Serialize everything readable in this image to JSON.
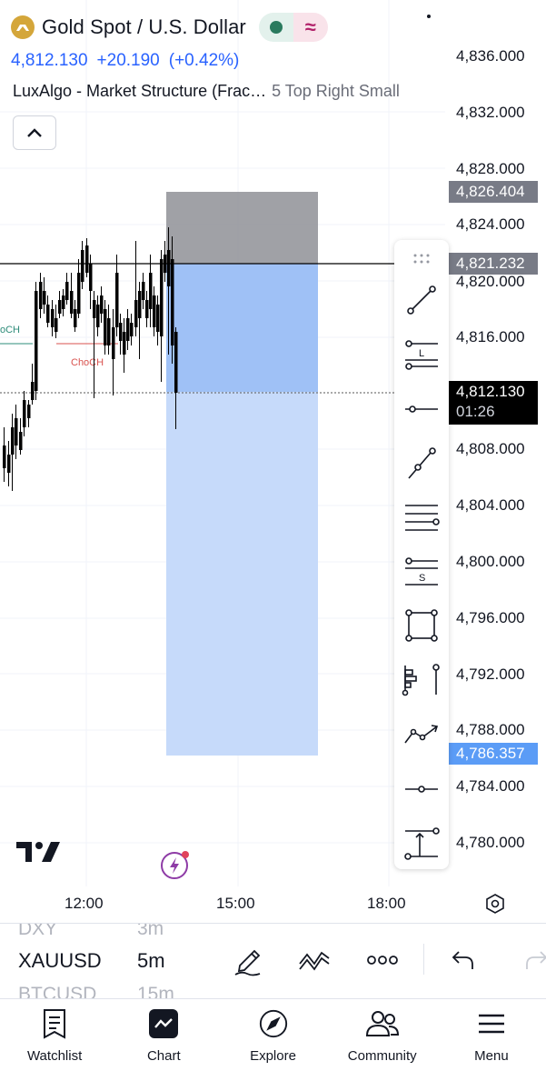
{
  "header": {
    "symbol_title": "Gold Spot / U.S. Dollar",
    "last_price": "4,812.130",
    "change": "+20.190",
    "change_pct": "(+0.42%)",
    "indicator_name": "LuxAlgo - Market Structure (Frac…",
    "indicator_params": "5 Top Right Small",
    "market_status_icon": "market-open-dot-icon",
    "data_feed_icon": "realtime-wave-icon"
  },
  "price_axis": {
    "labels": [
      "4,836.000",
      "4,832.000",
      "4,828.000",
      "4,824.000",
      "4,820.000",
      "4,816.000",
      "4,808.000",
      "4,804.000",
      "4,800.000",
      "4,796.000",
      "4,792.000",
      "4,788.000",
      "4,784.000",
      "4,780.000"
    ],
    "tag_stop": "4,826.404",
    "tag_entry": "4,821.232",
    "tag_current_price": "4,812.130",
    "tag_countdown": "01:26",
    "tag_target": "4,786.357"
  },
  "chart": {
    "choch_label_left": "oCH",
    "choch_label_mid": "ChoCH",
    "colors": {
      "up_candle": "#2962ff",
      "down_candle": "#000000",
      "stop_zone": "#8f9196",
      "target_zone_dark": "#9fc1f6",
      "target_zone_light": "#c6dafa",
      "choch_bull": "#2e8c7a",
      "choch_bear": "#d9534f"
    }
  },
  "time_axis": {
    "labels": [
      "12:00",
      "15:00",
      "18:00"
    ]
  },
  "drawing_tools": [
    "trend-line-icon",
    "long-position-lines-icon",
    "horizontal-ray-icon",
    "ray-line-icon",
    "parallel-channel-icon",
    "short-position-lines-icon",
    "rectangle-icon",
    "price-range-icon",
    "path-arrow-icon",
    "horizontal-segment-icon",
    "vertical-measure-icon"
  ],
  "symbol_bar": {
    "prev_symbol": "DXY",
    "prev_interval": "3m",
    "current_symbol": "XAUUSD",
    "current_interval": "5m",
    "next_symbol": "BTCUSD",
    "next_interval": "15m"
  },
  "bottom_nav": [
    {
      "label": "Watchlist",
      "icon": "watchlist-icon"
    },
    {
      "label": "Chart",
      "icon": "chart-icon"
    },
    {
      "label": "Explore",
      "icon": "compass-icon"
    },
    {
      "label": "Community",
      "icon": "community-icon"
    },
    {
      "label": "Menu",
      "icon": "menu-icon"
    }
  ]
}
